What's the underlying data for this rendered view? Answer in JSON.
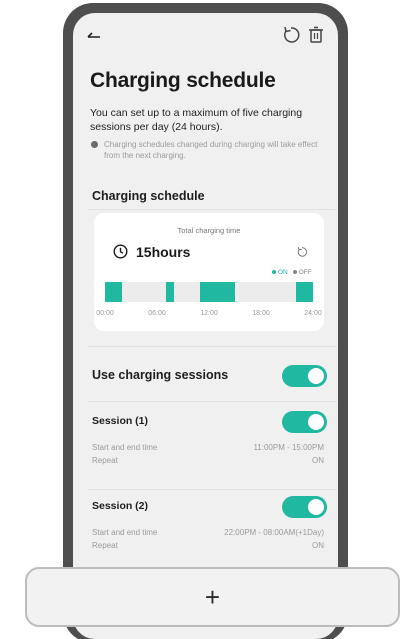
{
  "header": {
    "title": "Charging schedule",
    "description": "You can set up to a maximum of five charging sessions per day (24 hours).",
    "note": "Charging schedules changed during charging will take effect from the next charging."
  },
  "schedule_section": {
    "label": "Charging schedule",
    "total_label": "Total charging time",
    "total_value": "15hours",
    "legend_on": "ON",
    "legend_off": "OFF",
    "ticks": [
      "00:00",
      "06:00",
      "12:00",
      "18:00",
      "24:00"
    ],
    "on_intervals_hours": [
      [
        0,
        2
      ],
      [
        7,
        8
      ],
      [
        11,
        15
      ],
      [
        22,
        24
      ]
    ]
  },
  "use_sessions": {
    "label": "Use charging sessions",
    "enabled": true
  },
  "sessions": [
    {
      "title": "Session (1)",
      "enabled": true,
      "time_label": "Start and end time",
      "time_value": "11:00PM - 15:00PM",
      "repeat_label": "Repeat",
      "repeat_value": "ON"
    },
    {
      "title": "Session (2)",
      "enabled": true,
      "time_label": "Start and end time",
      "time_value": "22:00PM - 08:00AM(+1Day)",
      "repeat_label": "Repeat",
      "repeat_value": "ON"
    }
  ],
  "add_button": {
    "label": "+"
  },
  "colors": {
    "accent": "#21b8a2",
    "phone_frame": "#4e4e4e",
    "screen_bg": "#f0f0f0"
  },
  "icons": {
    "back": "back-arrow-icon",
    "refresh": "refresh-icon",
    "delete": "trash-icon",
    "clock": "clock-icon",
    "info": "info-dot-icon"
  }
}
